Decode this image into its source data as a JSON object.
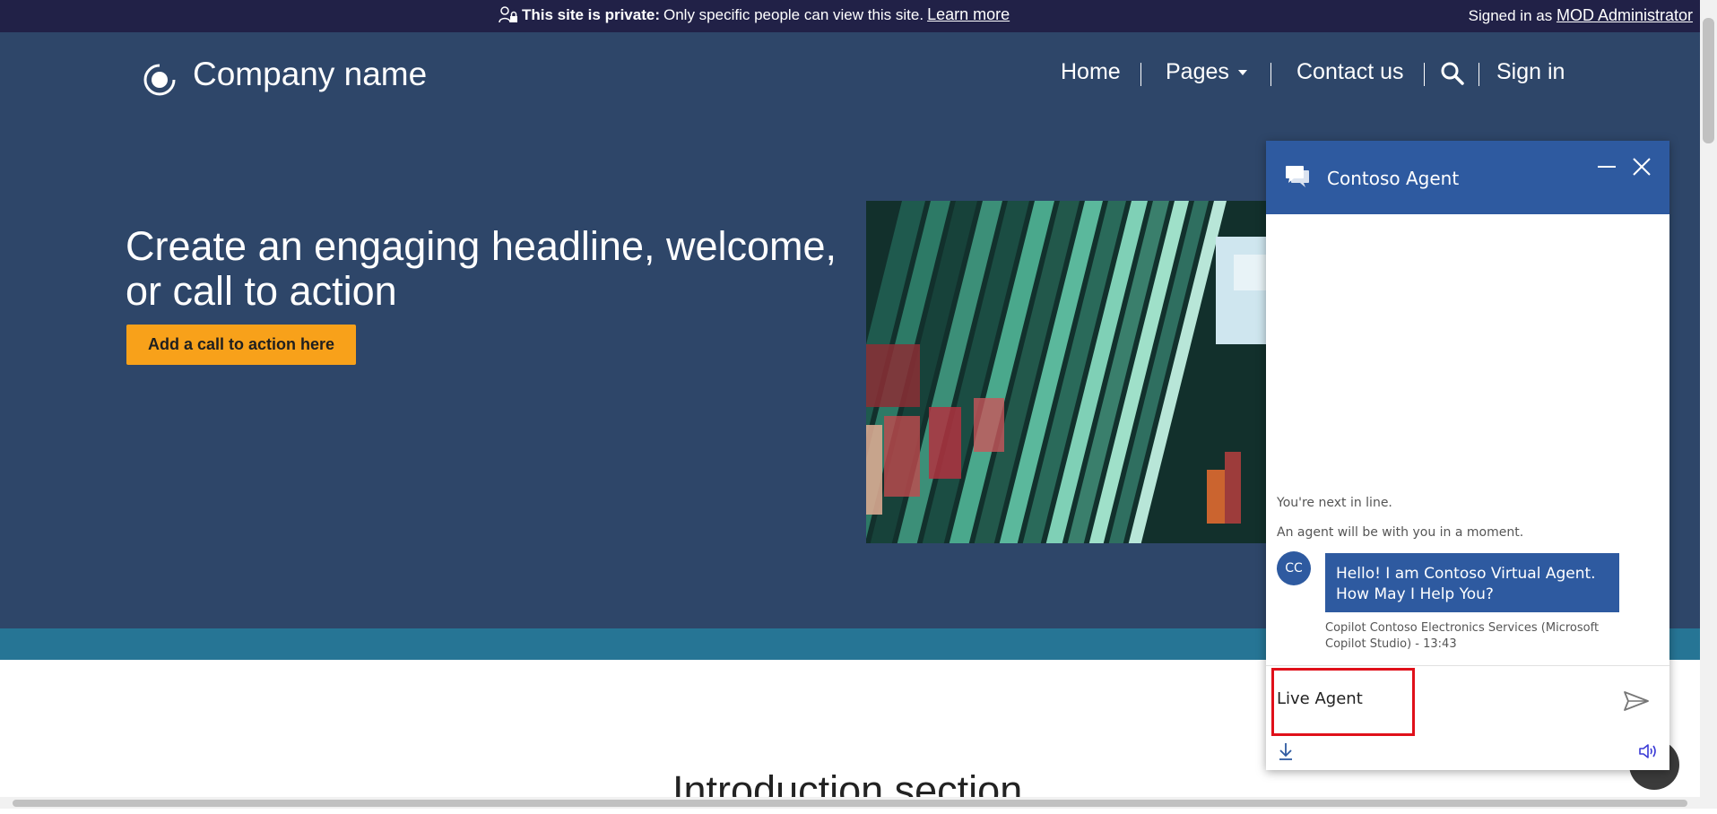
{
  "banner": {
    "icon": "people-lock-icon",
    "private_label": "This site is private:",
    "private_text": "Only specific people can view this site.",
    "learn_more": "Learn more",
    "signed_in_prefix": "Signed in as",
    "user": "MOD Administrator"
  },
  "header": {
    "logo_icon": "circle-logo-icon",
    "company": "Company name",
    "nav": {
      "home": "Home",
      "pages": "Pages",
      "contact": "Contact us",
      "search_icon": "search-icon",
      "sign_in": "Sign in"
    }
  },
  "hero": {
    "headline": "Create an engaging headline, welcome, or call to action",
    "cta": "Add a call to action here"
  },
  "intro": {
    "title": "Introduction section"
  },
  "chat": {
    "title": "Contoso Agent",
    "icons": [
      "chat-bubbles-icon",
      "minimize-icon",
      "close-icon",
      "send-icon",
      "download-icon",
      "speaker-icon"
    ],
    "system_messages": [
      "You're next in line.",
      "An agent will be with you in a moment."
    ],
    "avatar": "CC",
    "bot_message": "Hello! I am Contoso Virtual Agent. How May I Help You?",
    "sender_meta": "Copilot Contoso Electronics Services (Microsoft Copilot Studio) - 13:43",
    "input_value": "Live Agent"
  },
  "colors": {
    "banner": "#212147",
    "hero": "#2e4669",
    "teal_band": "#267595",
    "cta": "#f8a11a",
    "chat_header": "#2e5aa0",
    "highlight": "#e0101a"
  }
}
